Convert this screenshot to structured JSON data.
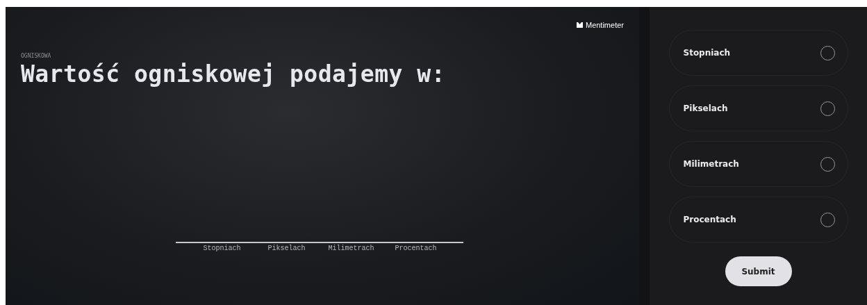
{
  "slide": {
    "brand": "Mentimeter",
    "label": "OGNISKOWA",
    "title": "Wartość ogniskowej podajemy w:",
    "results": {
      "axis_labels": [
        "Stopniach",
        "Pikselach",
        "Milimetrach",
        "Procentach"
      ]
    }
  },
  "voting": {
    "options": [
      {
        "label": "Stopniach",
        "selected": false
      },
      {
        "label": "Pikselach",
        "selected": false
      },
      {
        "label": "Milimetrach",
        "selected": false
      },
      {
        "label": "Procentach",
        "selected": false
      }
    ],
    "submit": "Submit"
  }
}
